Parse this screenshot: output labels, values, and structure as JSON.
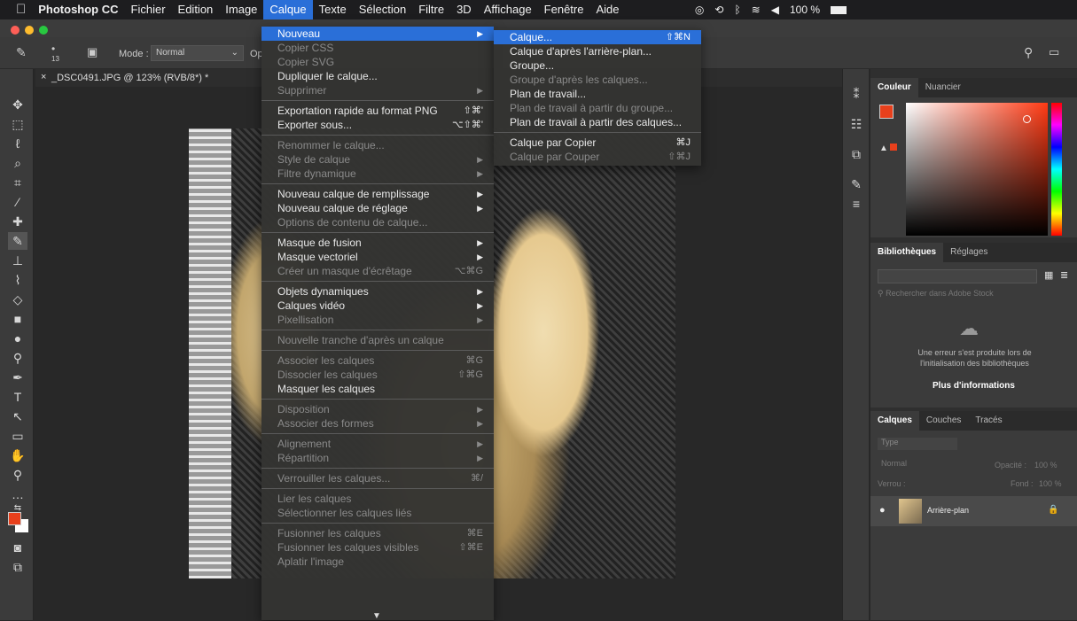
{
  "menubar": {
    "apple": "",
    "app": "Photoshop CC",
    "items": [
      "Fichier",
      "Edition",
      "Image",
      "Calque",
      "Texte",
      "Sélection",
      "Filtre",
      "3D",
      "Affichage",
      "Fenêtre",
      "Aide"
    ],
    "battery": "100 %"
  },
  "options": {
    "brush_size": "13",
    "mode_label": "Mode :",
    "mode_value": "Normal",
    "op": "Op"
  },
  "document": {
    "tab_title": "_DSC0491.JPG @ 123% (RVB/8*) *"
  },
  "calque_menu": [
    {
      "label": "Nouveau",
      "state": "selected",
      "arrow": "▶"
    },
    {
      "label": "Copier CSS",
      "state": "disabled"
    },
    {
      "label": "Copier SVG",
      "state": "disabled"
    },
    {
      "label": "Dupliquer le calque...",
      "state": "enabled"
    },
    {
      "label": "Supprimer",
      "state": "disabled",
      "arrow": "▶"
    },
    {
      "sep": true
    },
    {
      "label": "Exportation rapide au format PNG",
      "shortcut": "⇧⌘'",
      "state": "enabled"
    },
    {
      "label": "Exporter sous...",
      "shortcut": "⌥⇧⌘'",
      "state": "enabled"
    },
    {
      "sep": true
    },
    {
      "label": "Renommer le calque...",
      "state": "disabled"
    },
    {
      "label": "Style de calque",
      "state": "disabled",
      "arrow": "▶"
    },
    {
      "label": "Filtre dynamique",
      "state": "disabled",
      "arrow": "▶"
    },
    {
      "sep": true
    },
    {
      "label": "Nouveau calque de remplissage",
      "state": "enabled",
      "arrow": "▶"
    },
    {
      "label": "Nouveau calque de réglage",
      "state": "enabled",
      "arrow": "▶"
    },
    {
      "label": "Options de contenu de calque...",
      "state": "disabled"
    },
    {
      "sep": true
    },
    {
      "label": "Masque de fusion",
      "state": "enabled",
      "arrow": "▶"
    },
    {
      "label": "Masque vectoriel",
      "state": "enabled",
      "arrow": "▶"
    },
    {
      "label": "Créer un masque d'écrêtage",
      "shortcut": "⌥⌘G",
      "state": "disabled"
    },
    {
      "sep": true
    },
    {
      "label": "Objets dynamiques",
      "state": "enabled",
      "arrow": "▶"
    },
    {
      "label": "Calques vidéo",
      "state": "enabled",
      "arrow": "▶"
    },
    {
      "label": "Pixellisation",
      "state": "disabled",
      "arrow": "▶"
    },
    {
      "sep": true
    },
    {
      "label": "Nouvelle tranche d'après un calque",
      "state": "disabled"
    },
    {
      "sep": true
    },
    {
      "label": "Associer les calques",
      "shortcut": "⌘G",
      "state": "disabled"
    },
    {
      "label": "Dissocier les calques",
      "shortcut": "⇧⌘G",
      "state": "disabled"
    },
    {
      "label": "Masquer les calques",
      "state": "enabled"
    },
    {
      "sep": true
    },
    {
      "label": "Disposition",
      "state": "disabled",
      "arrow": "▶"
    },
    {
      "label": "Associer des formes",
      "state": "disabled",
      "arrow": "▶"
    },
    {
      "sep": true
    },
    {
      "label": "Alignement",
      "state": "disabled",
      "arrow": "▶"
    },
    {
      "label": "Répartition",
      "state": "disabled",
      "arrow": "▶"
    },
    {
      "sep": true
    },
    {
      "label": "Verrouiller les calques...",
      "shortcut": "⌘/",
      "state": "disabled"
    },
    {
      "sep": true
    },
    {
      "label": "Lier les calques",
      "state": "disabled"
    },
    {
      "label": "Sélectionner les calques liés",
      "state": "disabled"
    },
    {
      "sep": true
    },
    {
      "label": "Fusionner les calques",
      "shortcut": "⌘E",
      "state": "disabled"
    },
    {
      "label": "Fusionner les calques visibles",
      "shortcut": "⇧⌘E",
      "state": "disabled"
    },
    {
      "label": "Aplatir l'image",
      "state": "disabled"
    }
  ],
  "nouveau_submenu": [
    {
      "label": "Calque...",
      "shortcut": "⇧⌘N",
      "state": "selected"
    },
    {
      "label": "Calque d'après l'arrière-plan...",
      "state": "enabled"
    },
    {
      "label": "Groupe...",
      "state": "enabled"
    },
    {
      "label": "Groupe d'après les calques...",
      "state": "disabled"
    },
    {
      "label": "Plan de travail...",
      "state": "enabled"
    },
    {
      "label": "Plan de travail à partir du groupe...",
      "state": "disabled"
    },
    {
      "label": "Plan de travail à partir des calques...",
      "state": "enabled"
    },
    {
      "sep": true
    },
    {
      "label": "Calque par Copier",
      "shortcut": "⌘J",
      "state": "enabled"
    },
    {
      "label": "Calque par Couper",
      "shortcut": "⇧⌘J",
      "state": "disabled"
    }
  ],
  "color_panel": {
    "tabs": [
      "Couleur",
      "Nuancier"
    ],
    "foreground": "#e8401c"
  },
  "libraries_panel": {
    "tabs": [
      "Bibliothèques",
      "Réglages"
    ],
    "search_placeholder": "Rechercher dans Adobe Stock",
    "error": "Une erreur s'est produite lors de l'initialisation des bibliothèques",
    "more": "Plus d'informations"
  },
  "layers_panel": {
    "tabs": [
      "Calques",
      "Couches",
      "Tracés"
    ],
    "filter": "Type",
    "blend": "Normal",
    "opacity_label": "Opacité :",
    "opacity": "100 %",
    "lock_label": "Verrou :",
    "fill_label": "Fond :",
    "fill": "100 %",
    "layer_name": "Arrière-plan"
  }
}
